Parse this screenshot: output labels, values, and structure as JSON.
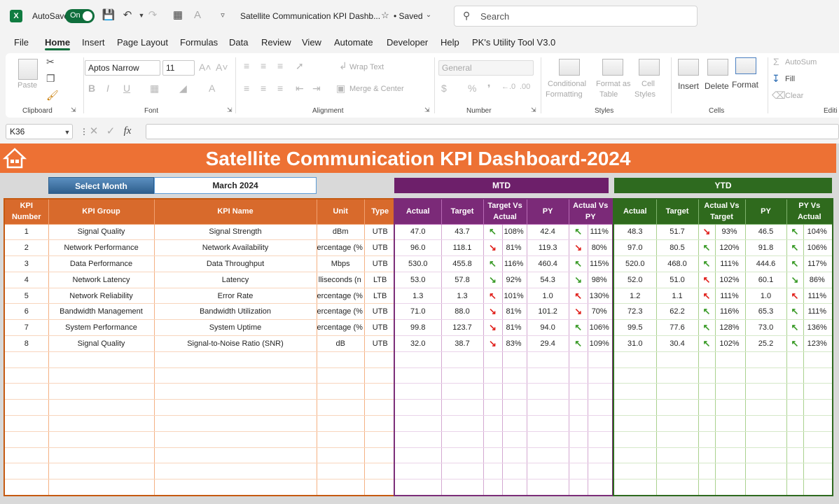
{
  "titlebar": {
    "autosave_label": "AutoSave",
    "toggle_label": "On",
    "doc_title": "Satellite Communication KPI Dashb...",
    "saved_label": "• Saved",
    "search_placeholder": "Search"
  },
  "menu": [
    "File",
    "Home",
    "Insert",
    "Page Layout",
    "Formulas",
    "Data",
    "Review",
    "View",
    "Automate",
    "Developer",
    "Help",
    "PK's Utility Tool V3.0"
  ],
  "ribbon": {
    "paste": "Paste",
    "font_name": "Aptos Narrow",
    "font_size": "11",
    "wrap_text": "Wrap Text",
    "merge_center": "Merge & Center",
    "number_format": "General",
    "cond_format": [
      "Conditional",
      "Formatting"
    ],
    "format_table": [
      "Format as",
      "Table"
    ],
    "cell_styles": [
      "Cell",
      "Styles"
    ],
    "insert": "Insert",
    "delete": "Delete",
    "format": "Format",
    "autosum": "AutoSum",
    "fill": "Fill",
    "clear": "Clear",
    "groups": {
      "clipboard": "Clipboard",
      "font": "Font",
      "alignment": "Alignment",
      "number": "Number",
      "styles": "Styles",
      "cells": "Cells",
      "editing": "Editi"
    }
  },
  "formula_bar": {
    "name_box": "K36",
    "fx": "fx",
    "content": ""
  },
  "dashboard": {
    "title": "Satellite Communication KPI Dashboard-2024",
    "select_month_label": "Select Month",
    "select_month_value": "March 2024",
    "mtd_label": "MTD",
    "ytd_label": "YTD",
    "left_headers": [
      "KPI Number",
      "KPI Group",
      "KPI Name",
      "Unit",
      "Type"
    ],
    "mtd_headers": [
      "Actual",
      "Target",
      "Target Vs Actual",
      "PY",
      "Actual Vs PY"
    ],
    "ytd_headers": [
      "Actual",
      "Target",
      "Actual Vs Target",
      "PY",
      "PY Vs Actual"
    ],
    "rows": [
      {
        "num": "1",
        "group": "Signal Quality",
        "name": "Signal Strength",
        "unit": "dBm",
        "type": "UTB",
        "mtd_actual": "47.0",
        "mtd_target": "43.7",
        "mtd_tva_arrow": "up",
        "mtd_tva": "108%",
        "mtd_py": "42.4",
        "mtd_avp_arrow": "up",
        "mtd_avp": "111%",
        "ytd_actual": "48.3",
        "ytd_target": "51.7",
        "ytd_avt_arrow": "down",
        "ytd_avt": "93%",
        "ytd_py": "46.5",
        "ytd_pva_arrow": "up",
        "ytd_pva": "104%"
      },
      {
        "num": "2",
        "group": "Network Performance",
        "name": "Network Availability",
        "unit": "ercentage (%",
        "type": "UTB",
        "mtd_actual": "96.0",
        "mtd_target": "118.1",
        "mtd_tva_arrow": "down",
        "mtd_tva": "81%",
        "mtd_py": "119.3",
        "mtd_avp_arrow": "down",
        "mtd_avp": "80%",
        "ytd_actual": "97.0",
        "ytd_target": "80.5",
        "ytd_avt_arrow": "up",
        "ytd_avt": "120%",
        "ytd_py": "91.8",
        "ytd_pva_arrow": "up",
        "ytd_pva": "106%"
      },
      {
        "num": "3",
        "group": "Data Performance",
        "name": "Data Throughput",
        "unit": "Mbps",
        "type": "UTB",
        "mtd_actual": "530.0",
        "mtd_target": "455.8",
        "mtd_tva_arrow": "up",
        "mtd_tva": "116%",
        "mtd_py": "460.4",
        "mtd_avp_arrow": "up",
        "mtd_avp": "115%",
        "ytd_actual": "520.0",
        "ytd_target": "468.0",
        "ytd_avt_arrow": "up",
        "ytd_avt": "111%",
        "ytd_py": "444.6",
        "ytd_pva_arrow": "up",
        "ytd_pva": "117%"
      },
      {
        "num": "4",
        "group": "Network Latency",
        "name": "Latency",
        "unit": "lliseconds (n",
        "type": "LTB",
        "mtd_actual": "53.0",
        "mtd_target": "57.8",
        "mtd_tva_arrow": "down-good",
        "mtd_tva": "92%",
        "mtd_py": "54.3",
        "mtd_avp_arrow": "down-good",
        "mtd_avp": "98%",
        "ytd_actual": "52.0",
        "ytd_target": "51.0",
        "ytd_avt_arrow": "up-bad",
        "ytd_avt": "102%",
        "ytd_py": "60.1",
        "ytd_pva_arrow": "down-good",
        "ytd_pva": "86%"
      },
      {
        "num": "5",
        "group": "Network Reliability",
        "name": "Error Rate",
        "unit": "ercentage (%",
        "type": "LTB",
        "mtd_actual": "1.3",
        "mtd_target": "1.3",
        "mtd_tva_arrow": "up-bad",
        "mtd_tva": "101%",
        "mtd_py": "1.0",
        "mtd_avp_arrow": "up-bad",
        "mtd_avp": "130%",
        "ytd_actual": "1.2",
        "ytd_target": "1.1",
        "ytd_avt_arrow": "up-bad",
        "ytd_avt": "111%",
        "ytd_py": "1.0",
        "ytd_pva_arrow": "up-bad",
        "ytd_pva": "111%"
      },
      {
        "num": "6",
        "group": "Bandwidth Management",
        "name": "Bandwidth Utilization",
        "unit": "ercentage (%",
        "type": "UTB",
        "mtd_actual": "71.0",
        "mtd_target": "88.0",
        "mtd_tva_arrow": "down",
        "mtd_tva": "81%",
        "mtd_py": "101.2",
        "mtd_avp_arrow": "down",
        "mtd_avp": "70%",
        "ytd_actual": "72.3",
        "ytd_target": "62.2",
        "ytd_avt_arrow": "up",
        "ytd_avt": "116%",
        "ytd_py": "65.3",
        "ytd_pva_arrow": "up",
        "ytd_pva": "111%"
      },
      {
        "num": "7",
        "group": "System Performance",
        "name": "System Uptime",
        "unit": "ercentage (%",
        "type": "UTB",
        "mtd_actual": "99.8",
        "mtd_target": "123.7",
        "mtd_tva_arrow": "down",
        "mtd_tva": "81%",
        "mtd_py": "94.0",
        "mtd_avp_arrow": "up",
        "mtd_avp": "106%",
        "ytd_actual": "99.5",
        "ytd_target": "77.6",
        "ytd_avt_arrow": "up",
        "ytd_avt": "128%",
        "ytd_py": "73.0",
        "ytd_pva_arrow": "up",
        "ytd_pva": "136%"
      },
      {
        "num": "8",
        "group": "Signal Quality",
        "name": "Signal-to-Noise Ratio (SNR)",
        "unit": "dB",
        "type": "UTB",
        "mtd_actual": "32.0",
        "mtd_target": "38.7",
        "mtd_tva_arrow": "down",
        "mtd_tva": "83%",
        "mtd_py": "29.4",
        "mtd_avp_arrow": "up",
        "mtd_avp": "109%",
        "ytd_actual": "31.0",
        "ytd_target": "30.4",
        "ytd_avt_arrow": "up",
        "ytd_avt": "102%",
        "ytd_py": "25.2",
        "ytd_pva_arrow": "up",
        "ytd_pva": "123%"
      }
    ],
    "colors": {
      "good": "#3a9b28",
      "bad": "#e0201b",
      "orange": "#ed7134",
      "mtd": "#6d1f6a",
      "ytd": "#2e6a1f"
    }
  }
}
